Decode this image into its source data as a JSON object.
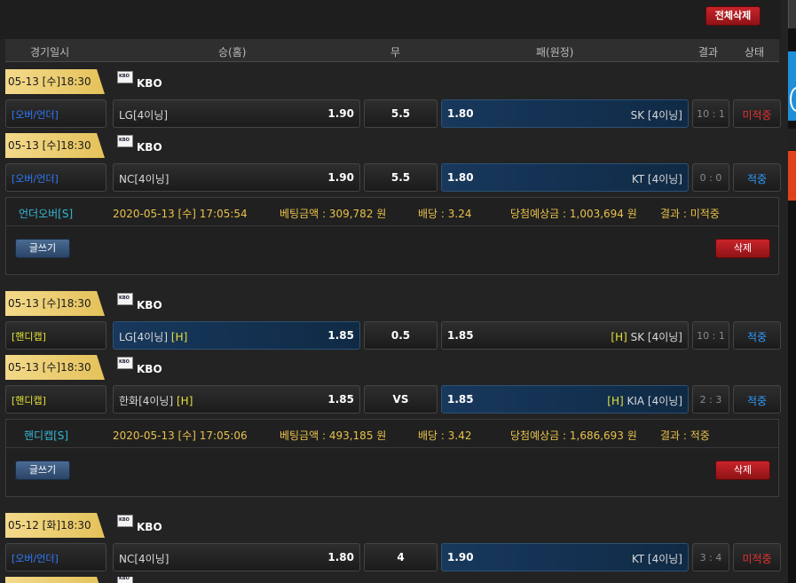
{
  "toolbar": {
    "delete_all": "전체삭제"
  },
  "header": {
    "date": "경기일시",
    "home": "승(홈)",
    "draw": "무",
    "away": "패(원정)",
    "result": "결과",
    "status": "상태"
  },
  "games": [
    {
      "date": "05-13 [수]18:30",
      "league": "KBO",
      "type": "[오버/언더]",
      "home": "LG[4이닝]",
      "home_h": "",
      "home_odds": "1.90",
      "draw": "5.5",
      "away_odds": "1.80",
      "away_h": "",
      "away": "SK [4이닝]",
      "score": "10 : 1",
      "status": "미적중"
    },
    {
      "date": "05-13 [수]18:30",
      "league": "KBO",
      "type": "[오버/언더]",
      "home": "NC[4이닝]",
      "home_h": "",
      "home_odds": "1.90",
      "draw": "5.5",
      "away_odds": "1.80",
      "away_h": "",
      "away": "KT [4이닝]",
      "score": "0 : 0",
      "status": "적중"
    },
    {
      "date": "05-13 [수]18:30",
      "league": "KBO",
      "type": "[핸디캡]",
      "home": "LG[4이닝]",
      "home_h": "[H]",
      "home_odds": "1.85",
      "draw": "0.5",
      "away_odds": "1.85",
      "away_h": "[H]",
      "away": "SK [4이닝]",
      "score": "10 : 1",
      "status": "적중"
    },
    {
      "date": "05-13 [수]18:30",
      "league": "KBO",
      "type": "[핸디캡]",
      "home": "한화[4이닝]",
      "home_h": "[H]",
      "home_odds": "1.85",
      "draw": "VS",
      "away_odds": "1.85",
      "away_h": "[H]",
      "away": "KIA [4이닝]",
      "score": "2 : 3",
      "status": "적중"
    },
    {
      "date": "05-12 [화]18:30",
      "league": "KBO",
      "type": "[오버/언더]",
      "home": "NC[4이닝]",
      "home_h": "",
      "home_odds": "1.80",
      "draw": "4",
      "away_odds": "1.90",
      "away_h": "",
      "away": "KT [4이닝]",
      "score": "3 : 4",
      "status": "미적중"
    }
  ],
  "bets": [
    {
      "type": "언더오버[S]",
      "datetime": "2020-05-13 [수] 17:05:54",
      "amount": "베팅금액 : 309,782 원",
      "rate": "배당 : 3.24",
      "expected": "당첨예상금 : 1,003,694 원",
      "result": "결과 : 미적중",
      "write": "글쓰기",
      "delete": "삭제"
    },
    {
      "type": "핸디캡[S]",
      "datetime": "2020-05-13 [수] 17:05:06",
      "amount": "베팅금액 : 493,185 원",
      "rate": "배당 : 3.42",
      "expected": "당첨예상금 : 1,686,693 원",
      "result": "결과 : 적중",
      "write": "글쓰기",
      "delete": "삭제"
    }
  ]
}
